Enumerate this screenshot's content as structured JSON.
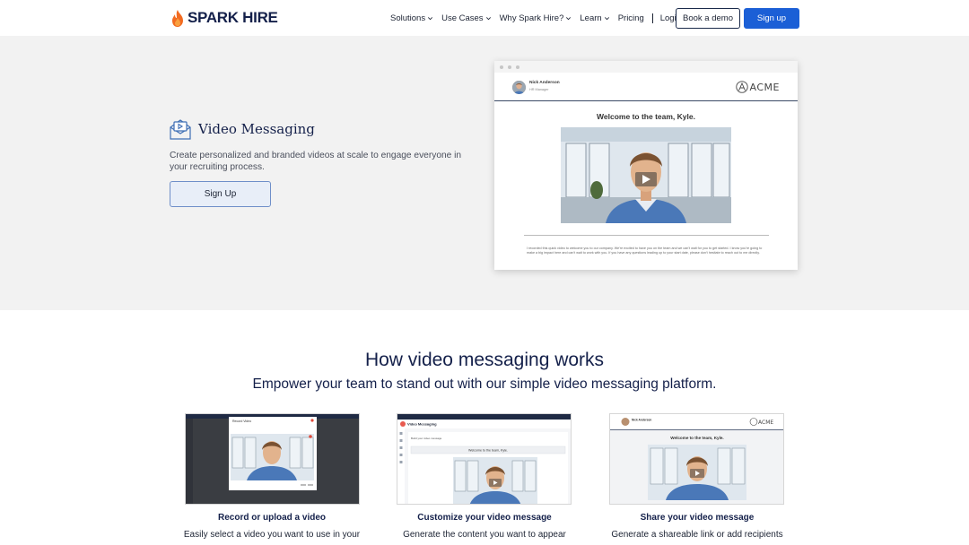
{
  "brand": {
    "name": "SPARK HIRE",
    "flame_color": "#f26b21",
    "navy": "#14204a",
    "accent": "#1b5fd6"
  },
  "nav": {
    "items": [
      {
        "label": "Solutions",
        "dropdown": true
      },
      {
        "label": "Use Cases",
        "dropdown": true
      },
      {
        "label": "Why Spark Hire?",
        "dropdown": true
      },
      {
        "label": "Learn",
        "dropdown": true
      },
      {
        "label": "Pricing",
        "dropdown": false
      }
    ],
    "login_label": "Login",
    "demo_label": "Book a demo",
    "signup_label": "Sign up"
  },
  "hero": {
    "icon": "video-mail-icon",
    "title": "Video Messaging",
    "description": "Create personalized and branded videos at scale to engage everyone in your recruiting process.",
    "button_label": "Sign Up",
    "mockup": {
      "sender_name": "Nick Anderson",
      "sender_sub": "HR Manager",
      "company_logo": "ACME",
      "welcome": "Welcome to the team, Kyle.",
      "message": "I recorded this quick video to welcome you to our company. We're excited to have you on the team and we can't wait for you to get started. I know you're going to make a big impact here and can't wait to work with you. If you have any questions leading up to your start date, please don't hesitate to reach out to me directly."
    }
  },
  "how": {
    "title": "How video messaging works",
    "subtitle": "Empower your team to stand out with our simple video messaging platform.",
    "cards": [
      {
        "title": "Record or upload a video",
        "description": "Easily select a video you want to use in your",
        "screen_label": "Record Video"
      },
      {
        "title": "Customize your video message",
        "description": "Generate the content you want to appear",
        "screen_label": "Video Messaging",
        "screen_sub": "Build your video message",
        "welcome": "Welcome to the team, Kyle."
      },
      {
        "title": "Share your video message",
        "description": "Generate a shareable link or add recipients",
        "sender_name": "Nick Anderson",
        "company_logo": "ACME",
        "welcome": "Welcome to the team, Kyle."
      }
    ]
  }
}
